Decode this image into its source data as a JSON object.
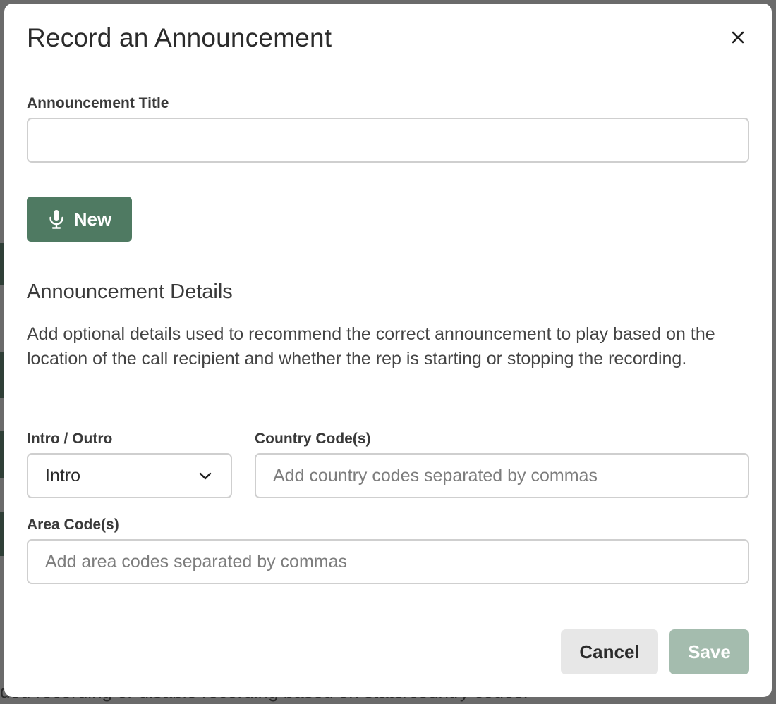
{
  "background": {
    "footer_text": "ded recording or disable recording based on state/country codes."
  },
  "modal": {
    "title": "Record an Announcement",
    "close_icon": "close-icon",
    "announcement_title": {
      "label": "Announcement Title",
      "value": "",
      "placeholder": ""
    },
    "new_button": {
      "label": "New",
      "icon": "microphone-icon",
      "color": "#4f7a62"
    },
    "details": {
      "title": "Announcement Details",
      "description": "Add optional details used to recommend the correct announcement to play based on the location of the call recipient and whether the rep is starting or stopping the recording."
    },
    "intro_outro": {
      "label": "Intro / Outro",
      "selected": "Intro",
      "icon": "chevron-down-icon"
    },
    "country_codes": {
      "label": "Country Code(s)",
      "value": "",
      "placeholder": "Add country codes separated by commas"
    },
    "area_codes": {
      "label": "Area Code(s)",
      "value": "",
      "placeholder": "Add area codes separated by commas"
    },
    "footer": {
      "cancel_label": "Cancel",
      "save_label": "Save",
      "save_color": "#a4bcae"
    }
  }
}
